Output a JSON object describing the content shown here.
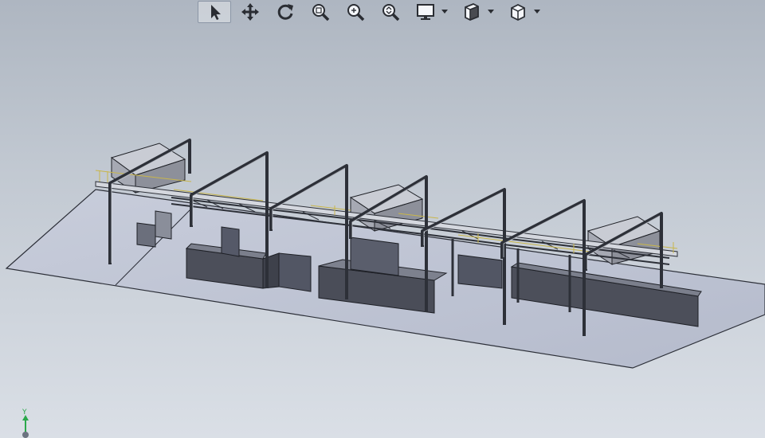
{
  "toolbar": {
    "tools": [
      {
        "id": "select",
        "icon": "select-arrow-icon",
        "active": true
      },
      {
        "id": "pan",
        "icon": "pan-icon",
        "active": false
      },
      {
        "id": "rotate",
        "icon": "rotate-icon",
        "active": false
      },
      {
        "id": "zoom-fit",
        "icon": "zoom-to-fit-icon",
        "active": false
      },
      {
        "id": "zoom-area",
        "icon": "zoom-area-icon",
        "active": false
      },
      {
        "id": "zoom-in-out",
        "icon": "zoom-in-out-icon",
        "active": false
      },
      {
        "id": "display-style",
        "icon": "display-monitor-icon",
        "active": false,
        "dropdown": true
      },
      {
        "id": "section-view",
        "icon": "section-view-icon",
        "active": false,
        "dropdown": true
      },
      {
        "id": "view-orientation",
        "icon": "view-cube-icon",
        "active": false,
        "dropdown": true
      }
    ]
  },
  "triad": {
    "axis_label": "Y"
  },
  "colors": {
    "background_top": "#aeb6c1",
    "background_bottom": "#dadfe6",
    "floor": "#bcc2d2",
    "wall": "#4c4f5a",
    "frame": "#2d3038",
    "railing": "#c9b64a",
    "triad_y_axis": "#2aa84a"
  }
}
